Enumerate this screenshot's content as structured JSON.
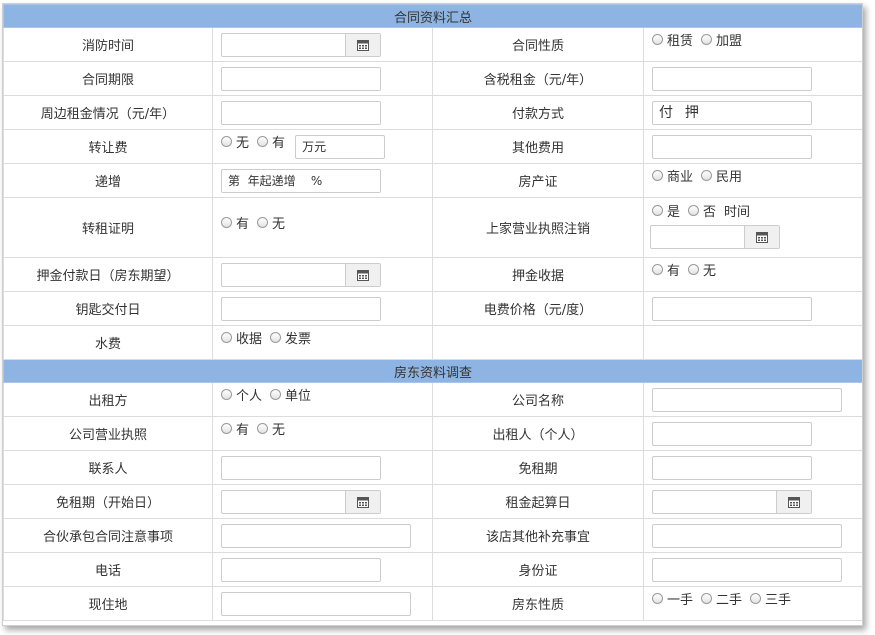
{
  "section1": {
    "title": "合同资料汇总",
    "rows": [
      {
        "l1": "消防时间",
        "l2": "合同性质",
        "o1": "租赁",
        "o2": "加盟"
      },
      {
        "l1": "合同期限",
        "l2": "含税租金（元/年）"
      },
      {
        "l1": "周边租金情况（元/年）",
        "l2": "付款方式",
        "pay_value": "付  押"
      },
      {
        "l1": "转让费",
        "o1": "无",
        "o2": "有",
        "unit": "万元",
        "l2": "其他费用"
      },
      {
        "l1": "递增",
        "inc_value": "第  年起递增    %",
        "l2": "房产证",
        "o3": "商业",
        "o4": "民用"
      },
      {
        "l1": "转租证明",
        "o1": "有",
        "o2": "无",
        "l2": "上家营业执照注销",
        "o3": "是",
        "o4": "否",
        "time": "时间"
      },
      {
        "l1": "押金付款日（房东期望）",
        "l2": "押金收据",
        "o1": "有",
        "o2": "无"
      },
      {
        "l1": "钥匙交付日",
        "l2": "电费价格（元/度）"
      },
      {
        "l1": "水费",
        "o1": "收据",
        "o2": "发票"
      }
    ]
  },
  "section2": {
    "title": "房东资料调查",
    "rows": [
      {
        "l1": "出租方",
        "o1": "个人",
        "o2": "单位",
        "l2": "公司名称"
      },
      {
        "l1": "公司营业执照",
        "o1": "有",
        "o2": "无",
        "l2": "出租人（个人）"
      },
      {
        "l1": "联系人",
        "l2": "免租期"
      },
      {
        "l1": "免租期（开始日）",
        "l2": "租金起算日"
      },
      {
        "l1": "合伙承包合同注意事项",
        "l2": "该店其他补充事宜"
      },
      {
        "l1": "电话",
        "l2": "身份证"
      },
      {
        "l1": "现住地",
        "l2": "房东性质",
        "o1": "一手",
        "o2": "二手",
        "o3": "三手"
      }
    ]
  },
  "icons": {
    "calendar": "calendar-icon",
    "radio": "radio-button"
  }
}
